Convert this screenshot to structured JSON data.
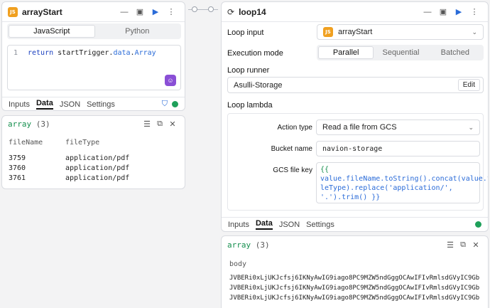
{
  "left_node": {
    "title": "arrayStart",
    "lang_tabs": [
      "JavaScript",
      "Python"
    ],
    "code": {
      "line_no": "1",
      "keyword": "return",
      "expr_plain": "startTrigger",
      "expr_dot1": ".",
      "expr_prop1": "data",
      "expr_dot2": ".",
      "expr_prop2": "Array"
    },
    "bottom_tabs": [
      "Inputs",
      "Data",
      "JSON",
      "Settings"
    ],
    "active_tab": "Data"
  },
  "left_output": {
    "label": "array",
    "count": "(3)",
    "columns": [
      "fileName",
      "fileType"
    ],
    "rows": [
      [
        "3759",
        "application/pdf"
      ],
      [
        "3760",
        "application/pdf"
      ],
      [
        "3761",
        "application/pdf"
      ]
    ]
  },
  "right_node": {
    "title": "loop14",
    "loop_input_label": "Loop input",
    "loop_input_value": "arrayStart",
    "execution_mode_label": "Execution mode",
    "modes": [
      "Parallel",
      "Sequential",
      "Batched"
    ],
    "selected_mode": "Parallel",
    "loop_runner_label": "Loop runner",
    "loop_runner_value": "Asulli-Storage",
    "edit_label": "Edit",
    "loop_lambda_label": "Loop lambda",
    "action_type_label": "Action type",
    "action_type_value": "Read a file from GCS",
    "bucket_name_label": "Bucket name",
    "bucket_name_value": "navion-storage",
    "gcs_file_key_label": "GCS file key",
    "gcs_lines": [
      "{{",
      "value.fileName.toString().concat(value.fi",
      "leType).replace('application/',",
      "'.').trim() }}"
    ],
    "bottom_tabs": [
      "Inputs",
      "Data",
      "JSON",
      "Settings"
    ],
    "active_tab": "Data"
  },
  "right_output": {
    "label": "array",
    "count": "(3)",
    "column": "body",
    "rows": [
      "JVBERi0xLjUKJcfsj6IKNyAwIG9iago8PC9MZW5ndGggOCAwIFIvRmlsdGVyIC9Gb",
      "JVBERi0xLjUKJcfsj6IKNyAwIG9iago8PC9MZW5ndGggOCAwIFIvRmlsdGVyIC9Gb",
      "JVBERi0xLjUKJcfsj6IKNyAwIG9iago8PC9MZW5ndGggOCAwIFIvRmlsdGVyIC9Gb"
    ]
  },
  "colors": {
    "accent_blue": "#2a6bd8",
    "js_badge": "#f0a020",
    "output_green": "#158f4e"
  }
}
